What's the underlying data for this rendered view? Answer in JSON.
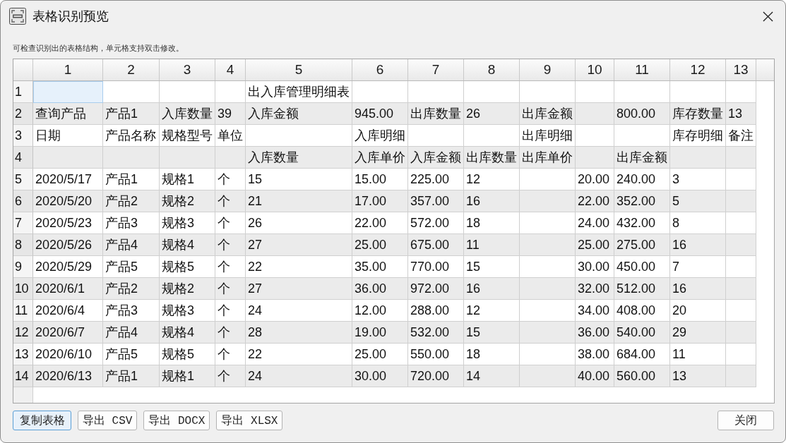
{
  "window": {
    "title": "表格识别预览"
  },
  "hint": "可检查识别出的表格结构，单元格支持双击修改。",
  "table": {
    "columns": [
      "1",
      "2",
      "3",
      "4",
      "5",
      "6",
      "7",
      "8",
      "9",
      "10",
      "11",
      "12",
      "13"
    ],
    "rows": [
      {
        "label": "1",
        "cells": [
          {
            "selected": true
          },
          {
            "selected": false
          },
          {
            "selected": false
          },
          {
            "selected": false
          },
          {
            "text": "出入库管理明细表",
            "selected": false
          },
          {
            "selected": false
          },
          {
            "selected": false
          },
          {
            "selected": false
          },
          {
            "selected": false
          },
          {
            "selected": false
          },
          {
            "selected": false
          },
          {
            "selected": false
          },
          {
            "selected": false
          }
        ]
      },
      {
        "label": "2",
        "cells": [
          {
            "text": "查询产品",
            "selected": false
          },
          {
            "text": "产品1",
            "selected": false
          },
          {
            "text": "入库数量",
            "selected": false
          },
          {
            "text": "39",
            "selected": false
          },
          {
            "text": "入库金额",
            "selected": false
          },
          {
            "text": "945.00",
            "selected": false
          },
          {
            "text": "出库数量",
            "selected": false
          },
          {
            "text": "26",
            "selected": false
          },
          {
            "text": "出库金额",
            "selected": false
          },
          {
            "selected": false
          },
          {
            "text": "800.00",
            "selected": false
          },
          {
            "text": "库存数量",
            "selected": false
          },
          {
            "text": "13",
            "selected": false
          }
        ]
      },
      {
        "label": "3",
        "cells": [
          {
            "text": "日期",
            "selected": false
          },
          {
            "text": "产品名称",
            "selected": false
          },
          {
            "text": "规格型号",
            "selected": false
          },
          {
            "text": "单位",
            "selected": false
          },
          {
            "selected": false
          },
          {
            "text": "入库明细",
            "selected": false
          },
          {
            "selected": false
          },
          {
            "selected": false
          },
          {
            "text": "出库明细",
            "selected": false
          },
          {
            "selected": false
          },
          {
            "selected": false
          },
          {
            "text": "库存明细",
            "selected": false
          },
          {
            "text": "备注",
            "selected": false
          }
        ]
      },
      {
        "label": "4",
        "cells": [
          {
            "selected": false
          },
          {
            "selected": false
          },
          {
            "selected": false
          },
          {
            "selected": false
          },
          {
            "text": "入库数量",
            "selected": false
          },
          {
            "text": "入库单价",
            "selected": false
          },
          {
            "text": "入库金额",
            "selected": false
          },
          {
            "text": "出库数量",
            "selected": false
          },
          {
            "text": "出库单价",
            "selected": false
          },
          {
            "selected": false
          },
          {
            "text": "出库金额",
            "selected": false
          },
          {
            "selected": false
          },
          {
            "selected": false
          }
        ]
      },
      {
        "label": "5",
        "cells": [
          {
            "text": "2020/5/17",
            "selected": false
          },
          {
            "text": "产品1",
            "selected": false
          },
          {
            "text": "规格1",
            "selected": false
          },
          {
            "text": "个",
            "selected": false
          },
          {
            "text": "15",
            "selected": false
          },
          {
            "text": "15.00",
            "selected": false
          },
          {
            "text": "225.00",
            "selected": false
          },
          {
            "text": "12",
            "selected": false
          },
          {
            "selected": false
          },
          {
            "text": "20.00",
            "selected": false
          },
          {
            "text": "240.00",
            "selected": false
          },
          {
            "text": "3",
            "selected": false
          },
          {
            "selected": false
          }
        ]
      },
      {
        "label": "6",
        "cells": [
          {
            "text": "2020/5/20",
            "selected": false
          },
          {
            "text": "产品2",
            "selected": false
          },
          {
            "text": "规格2",
            "selected": false
          },
          {
            "text": "个",
            "selected": false
          },
          {
            "text": "21",
            "selected": false
          },
          {
            "text": "17.00",
            "selected": false
          },
          {
            "text": "357.00",
            "selected": false
          },
          {
            "text": "16",
            "selected": false
          },
          {
            "selected": false
          },
          {
            "text": "22.00",
            "selected": false
          },
          {
            "text": "352.00",
            "selected": false
          },
          {
            "text": "5",
            "selected": false
          },
          {
            "selected": false
          }
        ]
      },
      {
        "label": "7",
        "cells": [
          {
            "text": "2020/5/23",
            "selected": false
          },
          {
            "text": "产品3",
            "selected": false
          },
          {
            "text": "规格3",
            "selected": false
          },
          {
            "text": "个",
            "selected": false
          },
          {
            "text": "26",
            "selected": false
          },
          {
            "text": "22.00",
            "selected": false
          },
          {
            "text": "572.00",
            "selected": false
          },
          {
            "text": "18",
            "selected": false
          },
          {
            "selected": false
          },
          {
            "text": "24.00",
            "selected": false
          },
          {
            "text": "432.00",
            "selected": false
          },
          {
            "text": "8",
            "selected": false
          },
          {
            "selected": false
          }
        ]
      },
      {
        "label": "8",
        "cells": [
          {
            "text": "2020/5/26",
            "selected": false
          },
          {
            "text": "产品4",
            "selected": false
          },
          {
            "text": "规格4",
            "selected": false
          },
          {
            "text": "个",
            "selected": false
          },
          {
            "text": "27",
            "selected": false
          },
          {
            "text": "25.00",
            "selected": false
          },
          {
            "text": "675.00",
            "selected": false
          },
          {
            "text": "11",
            "selected": false
          },
          {
            "selected": false
          },
          {
            "text": "25.00",
            "selected": false
          },
          {
            "text": "275.00",
            "selected": false
          },
          {
            "text": "16",
            "selected": false
          },
          {
            "selected": false
          }
        ]
      },
      {
        "label": "9",
        "cells": [
          {
            "text": "2020/5/29",
            "selected": false
          },
          {
            "text": "产品5",
            "selected": false
          },
          {
            "text": "规格5",
            "selected": false
          },
          {
            "text": "个",
            "selected": false
          },
          {
            "text": "22",
            "selected": false
          },
          {
            "text": "35.00",
            "selected": false
          },
          {
            "text": "770.00",
            "selected": false
          },
          {
            "text": "15",
            "selected": false
          },
          {
            "selected": false
          },
          {
            "text": "30.00",
            "selected": false
          },
          {
            "text": "450.00",
            "selected": false
          },
          {
            "text": "7",
            "selected": false
          },
          {
            "selected": false
          }
        ]
      },
      {
        "label": "10",
        "cells": [
          {
            "text": "2020/6/1",
            "selected": false
          },
          {
            "text": "产品2",
            "selected": false
          },
          {
            "text": "规格2",
            "selected": false
          },
          {
            "text": "个",
            "selected": false
          },
          {
            "text": "27",
            "selected": false
          },
          {
            "text": "36.00",
            "selected": false
          },
          {
            "text": "972.00",
            "selected": false
          },
          {
            "text": "16",
            "selected": false
          },
          {
            "selected": false
          },
          {
            "text": "32.00",
            "selected": false
          },
          {
            "text": "512.00",
            "selected": false
          },
          {
            "text": "16",
            "selected": false
          },
          {
            "selected": false
          }
        ]
      },
      {
        "label": "11",
        "cells": [
          {
            "text": "2020/6/4",
            "selected": false
          },
          {
            "text": "产品3",
            "selected": false
          },
          {
            "text": "规格3",
            "selected": false
          },
          {
            "text": "个",
            "selected": false
          },
          {
            "text": "24",
            "selected": false
          },
          {
            "text": "12.00",
            "selected": false
          },
          {
            "text": "288.00",
            "selected": false
          },
          {
            "text": "12",
            "selected": false
          },
          {
            "selected": false
          },
          {
            "text": "34.00",
            "selected": false
          },
          {
            "text": "408.00",
            "selected": false
          },
          {
            "text": "20",
            "selected": false
          },
          {
            "selected": false
          }
        ]
      },
      {
        "label": "12",
        "cells": [
          {
            "text": "2020/6/7",
            "selected": false
          },
          {
            "text": "产品4",
            "selected": false
          },
          {
            "text": "规格4",
            "selected": false
          },
          {
            "text": "个",
            "selected": false
          },
          {
            "text": "28",
            "selected": false
          },
          {
            "text": "19.00",
            "selected": false
          },
          {
            "text": "532.00",
            "selected": false
          },
          {
            "text": "15",
            "selected": false
          },
          {
            "selected": false
          },
          {
            "text": "36.00",
            "selected": false
          },
          {
            "text": "540.00",
            "selected": false
          },
          {
            "text": "29",
            "selected": false
          },
          {
            "selected": false
          }
        ]
      },
      {
        "label": "13",
        "cells": [
          {
            "text": "2020/6/10",
            "selected": false
          },
          {
            "text": "产品5",
            "selected": false
          },
          {
            "text": "规格5",
            "selected": false
          },
          {
            "text": "个",
            "selected": false
          },
          {
            "text": "22",
            "selected": false
          },
          {
            "text": "25.00",
            "selected": false
          },
          {
            "text": "550.00",
            "selected": false
          },
          {
            "text": "18",
            "selected": false
          },
          {
            "selected": false
          },
          {
            "text": "38.00",
            "selected": false
          },
          {
            "text": "684.00",
            "selected": false
          },
          {
            "text": "11",
            "selected": false
          },
          {
            "selected": false
          }
        ]
      },
      {
        "label": "14",
        "cells": [
          {
            "text": "2020/6/13",
            "selected": false
          },
          {
            "text": "产品1",
            "selected": false
          },
          {
            "text": "规格1",
            "selected": false
          },
          {
            "text": "个",
            "selected": false
          },
          {
            "text": "24",
            "selected": false
          },
          {
            "text": "30.00",
            "selected": false
          },
          {
            "text": "720.00",
            "selected": false
          },
          {
            "text": "14",
            "selected": false
          },
          {
            "selected": false
          },
          {
            "text": "40.00",
            "selected": false
          },
          {
            "text": "560.00",
            "selected": false
          },
          {
            "text": "13",
            "selected": false
          },
          {
            "selected": false
          }
        ]
      }
    ]
  },
  "actions": [
    {
      "label": "复制表格",
      "focused": true
    },
    {
      "label": "导出 CSV",
      "focused": false
    },
    {
      "label": "导出 DOCX",
      "focused": false
    },
    {
      "label": "导出 XLSX",
      "focused": false
    }
  ],
  "close_button": {
    "label": "关闭",
    "focused": false
  }
}
